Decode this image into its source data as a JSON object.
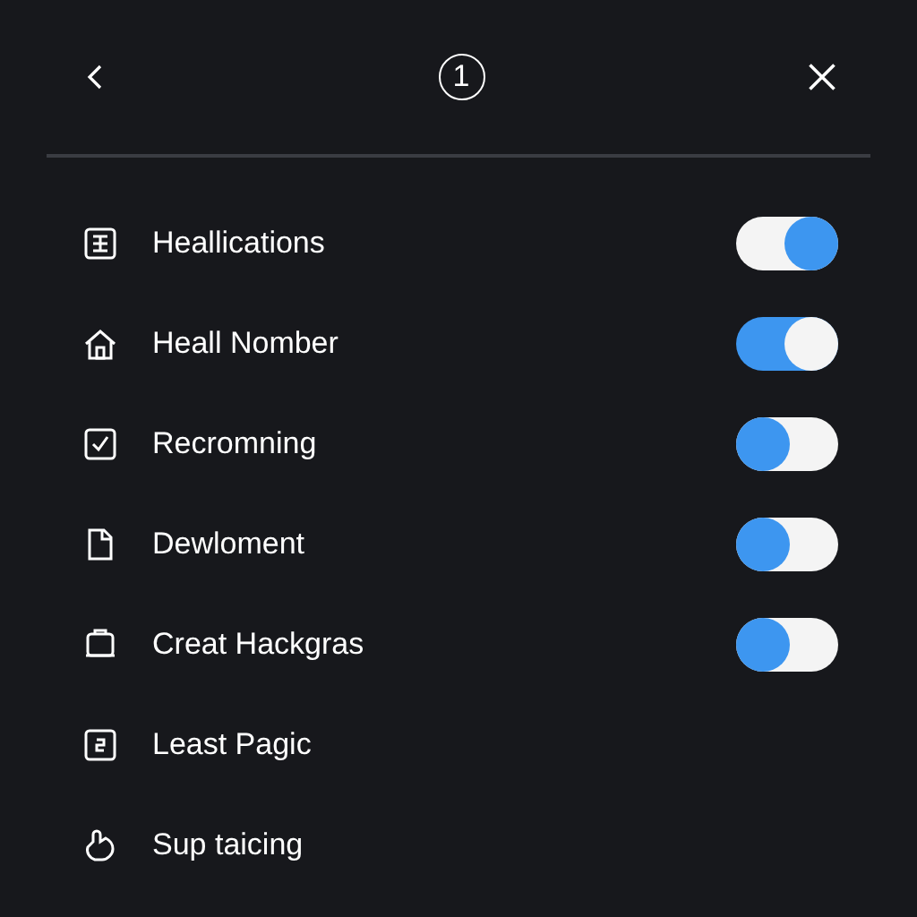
{
  "header": {
    "step": "1"
  },
  "items": [
    {
      "label": "Heallications",
      "toggle": {
        "kind": "plain",
        "on": true
      }
    },
    {
      "label": "Heall Nomber",
      "toggle": {
        "kind": "accent",
        "on": true
      }
    },
    {
      "label": "Recromning",
      "toggle": {
        "kind": "plain",
        "on": false
      }
    },
    {
      "label": "Dewloment",
      "toggle": {
        "kind": "plain",
        "on": false
      }
    },
    {
      "label": "Creat Hackgras",
      "toggle": {
        "kind": "plain",
        "on": false
      }
    },
    {
      "label": "Least Pagic"
    },
    {
      "label": "Sup taicing"
    }
  ]
}
